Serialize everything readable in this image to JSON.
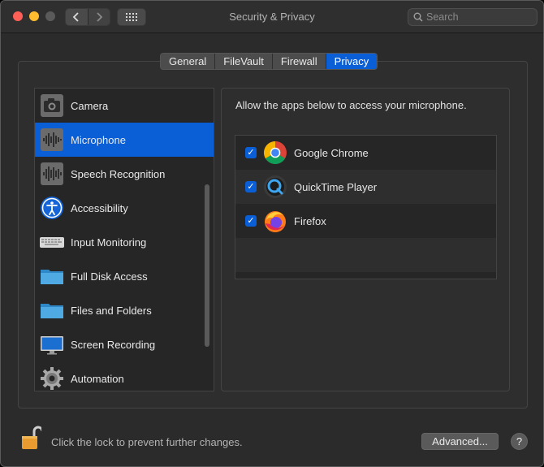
{
  "window": {
    "title": "Security & Privacy"
  },
  "toolbar": {
    "back_icon": "chevron-left-icon",
    "forward_icon": "chevron-right-icon",
    "show_all_icon": "grid-icon",
    "search_placeholder": "Search"
  },
  "tabs": [
    {
      "label": "General",
      "active": false
    },
    {
      "label": "FileVault",
      "active": false
    },
    {
      "label": "Firewall",
      "active": false
    },
    {
      "label": "Privacy",
      "active": true
    }
  ],
  "sidebar": {
    "items": [
      {
        "label": "Camera",
        "icon": "camera-icon",
        "selected": false
      },
      {
        "label": "Microphone",
        "icon": "microphone-icon",
        "selected": true
      },
      {
        "label": "Speech Recognition",
        "icon": "speech-recognition-icon",
        "selected": false
      },
      {
        "label": "Accessibility",
        "icon": "accessibility-icon",
        "selected": false
      },
      {
        "label": "Input Monitoring",
        "icon": "keyboard-icon",
        "selected": false
      },
      {
        "label": "Full Disk Access",
        "icon": "folder-icon",
        "selected": false
      },
      {
        "label": "Files and Folders",
        "icon": "folder-icon",
        "selected": false
      },
      {
        "label": "Screen Recording",
        "icon": "display-icon",
        "selected": false
      },
      {
        "label": "Automation",
        "icon": "gear-icon",
        "selected": false
      }
    ]
  },
  "panel": {
    "description": "Allow the apps below to access your microphone.",
    "apps": [
      {
        "name": "Google Chrome",
        "checked": true,
        "icon": "chrome-icon"
      },
      {
        "name": "QuickTime Player",
        "checked": true,
        "icon": "quicktime-icon"
      },
      {
        "name": "Firefox",
        "checked": true,
        "icon": "firefox-icon"
      }
    ]
  },
  "footer": {
    "lock_text": "Click the lock to prevent further changes.",
    "advanced_label": "Advanced...",
    "help_label": "?"
  },
  "colors": {
    "accent": "#0a5fd6",
    "window_bg": "#2b2b2b",
    "close": "#fe5f57",
    "minimize": "#febc2e"
  }
}
